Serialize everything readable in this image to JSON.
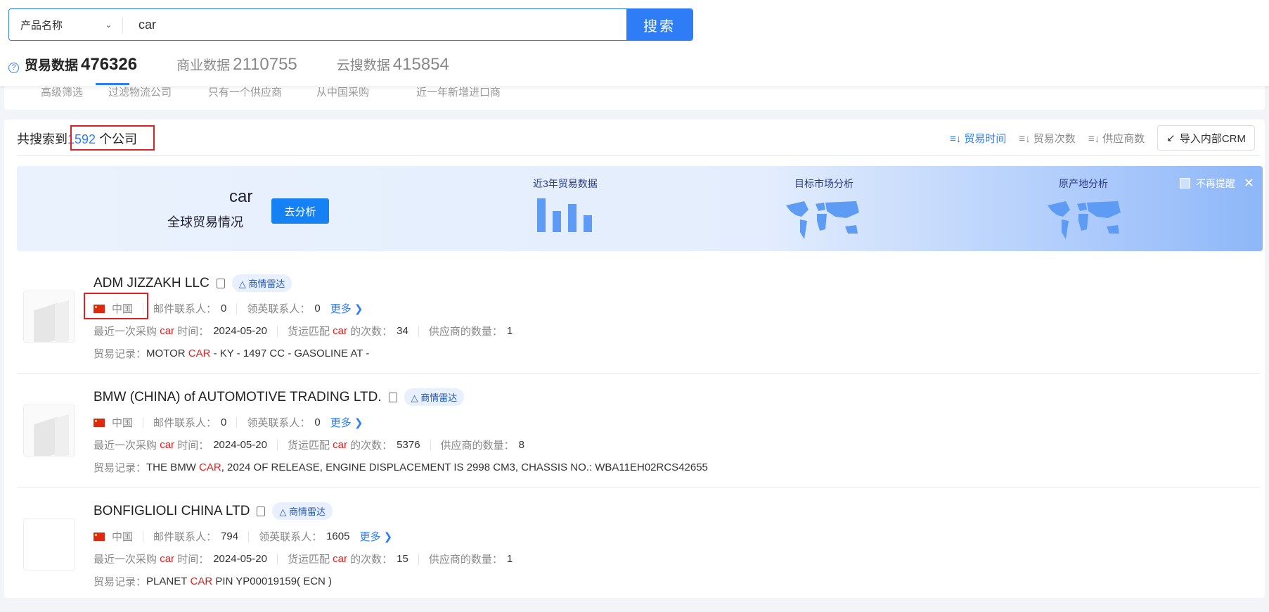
{
  "search": {
    "type_label": "产品名称",
    "query": "car",
    "button": "搜索"
  },
  "stats": [
    {
      "label": "贸易数据",
      "count": "476326"
    },
    {
      "label": "商业数据",
      "count": "2110755"
    },
    {
      "label": "云搜数据",
      "count": "415854"
    }
  ],
  "filter_tabs": [
    "高级筛选",
    "过滤物流公司",
    "只有一个供应商",
    "从中国采购",
    "近一年新增进口商"
  ],
  "results": {
    "prefix": "共搜索到",
    "count": "1592",
    "suffix": "个公司"
  },
  "sort": {
    "options": [
      "贸易时间",
      "贸易次数",
      "供应商数"
    ],
    "active": "贸易时间"
  },
  "crm_button": "导入内部CRM",
  "banner": {
    "keyword": "car",
    "subtitle": "全球贸易情况",
    "go_button": "去分析",
    "sections": [
      "近3年贸易数据",
      "目标市场分析",
      "原产地分析"
    ],
    "dismiss": "不再提醒"
  },
  "labels": {
    "email": "邮件联系人：",
    "linkedin": "领英联系人：",
    "more": "更多",
    "last_pre": "最近一次采购",
    "last_post": "时间：",
    "match_pre": "货运匹配",
    "match_post": "的次数：",
    "suppliers": "供应商的数量：",
    "record": "贸易记录：",
    "radar": "商情雷达",
    "kw": "car",
    "kw_upper": "CAR"
  },
  "companies": [
    {
      "name": "ADM JIZZAKH LLC",
      "country": "中国",
      "email_contacts": "0",
      "linkedin_contacts": "0",
      "last_purchase": "2024-05-20",
      "match_count": "34",
      "supplier_count": "1",
      "record_pre": "MOTOR",
      "record_post": "- KY - 1497 CC - GASOLINE AT -"
    },
    {
      "name": "BMW (CHINA) of AUTOMOTIVE TRADING LTD.",
      "country": "中国",
      "email_contacts": "0",
      "linkedin_contacts": "0",
      "last_purchase": "2024-05-20",
      "match_count": "5376",
      "supplier_count": "8",
      "record_pre": "THE BMW",
      "record_post": ", 2024 OF RELEASE, ENGINE DISPLACEMENT IS 2998 CM3, CHASSIS NO.: WBA11EH02RCS42655"
    },
    {
      "name": "BONFIGLIOLI CHINA LTD",
      "country": "中国",
      "email_contacts": "794",
      "linkedin_contacts": "1605",
      "last_purchase": "2024-05-20",
      "match_count": "15",
      "supplier_count": "1",
      "record_pre": "PLANET",
      "record_post": "PIN YP00019159( ECN )"
    }
  ],
  "colors": {
    "accent": "#2f7df6",
    "highlight": "#e02020"
  }
}
